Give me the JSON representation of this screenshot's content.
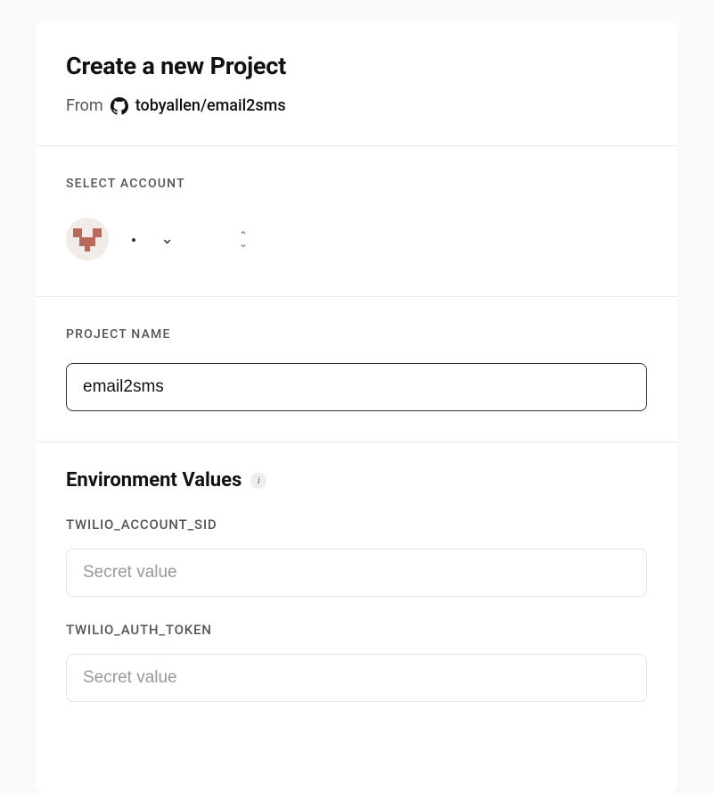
{
  "header": {
    "title": "Create a new Project",
    "from_label": "From",
    "repo": "tobyallen/email2sms"
  },
  "account": {
    "label": "SELECT ACCOUNT",
    "name": ""
  },
  "project": {
    "label": "PROJECT NAME",
    "value": "email2sms"
  },
  "env": {
    "title": "Environment Values",
    "info_symbol": "i",
    "vars": [
      {
        "name": "TWILIO_ACCOUNT_SID",
        "value": "",
        "placeholder": "Secret value"
      },
      {
        "name": "TWILIO_AUTH_TOKEN",
        "value": "",
        "placeholder": "Secret value"
      }
    ]
  }
}
